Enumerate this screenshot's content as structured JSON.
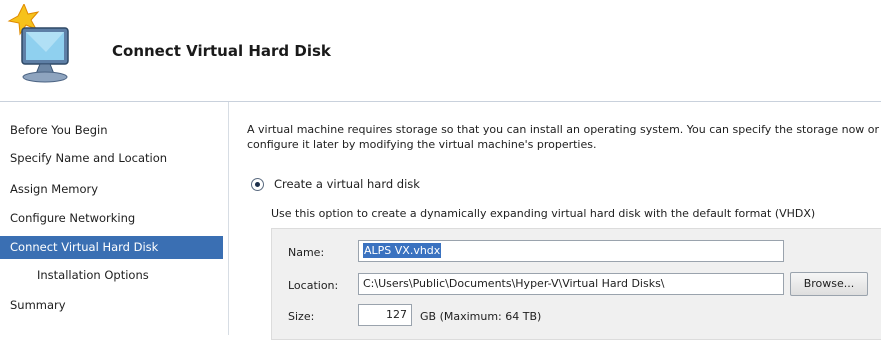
{
  "header": {
    "title": "Connect Virtual Hard Disk",
    "icon": "new-vm-wizard-icon"
  },
  "sidebar": {
    "items": [
      {
        "label": "Before You Begin",
        "selected": false
      },
      {
        "label": "Specify Name and Location",
        "selected": false
      },
      {
        "label": "Assign Memory",
        "selected": false
      },
      {
        "label": "Configure Networking",
        "selected": false
      },
      {
        "label": "Connect Virtual Hard Disk",
        "selected": true
      },
      {
        "label": "Installation Options",
        "selected": false
      },
      {
        "label": "Summary",
        "selected": false
      }
    ]
  },
  "main": {
    "description": "A virtual machine requires storage so that you can install an operating system. You can specify the storage now or configure it later by modifying the virtual machine's properties.",
    "create_option": {
      "label": "Create a virtual hard disk",
      "checked": true,
      "hint": "Use this option to create a dynamically expanding virtual hard disk with the default format (VHDX)"
    },
    "name": {
      "label": "Name:",
      "value": "ALPS VX.vhdx"
    },
    "location": {
      "label": "Location:",
      "value": "C:\\Users\\Public\\Documents\\Hyper-V\\Virtual Hard Disks\\",
      "browse_label": "Browse..."
    },
    "size": {
      "label": "Size:",
      "value": "127",
      "unit_text": "GB (Maximum: 64 TB)"
    }
  },
  "colors": {
    "selection": "#3a6fb3",
    "group_background": "#f0f0f0"
  }
}
